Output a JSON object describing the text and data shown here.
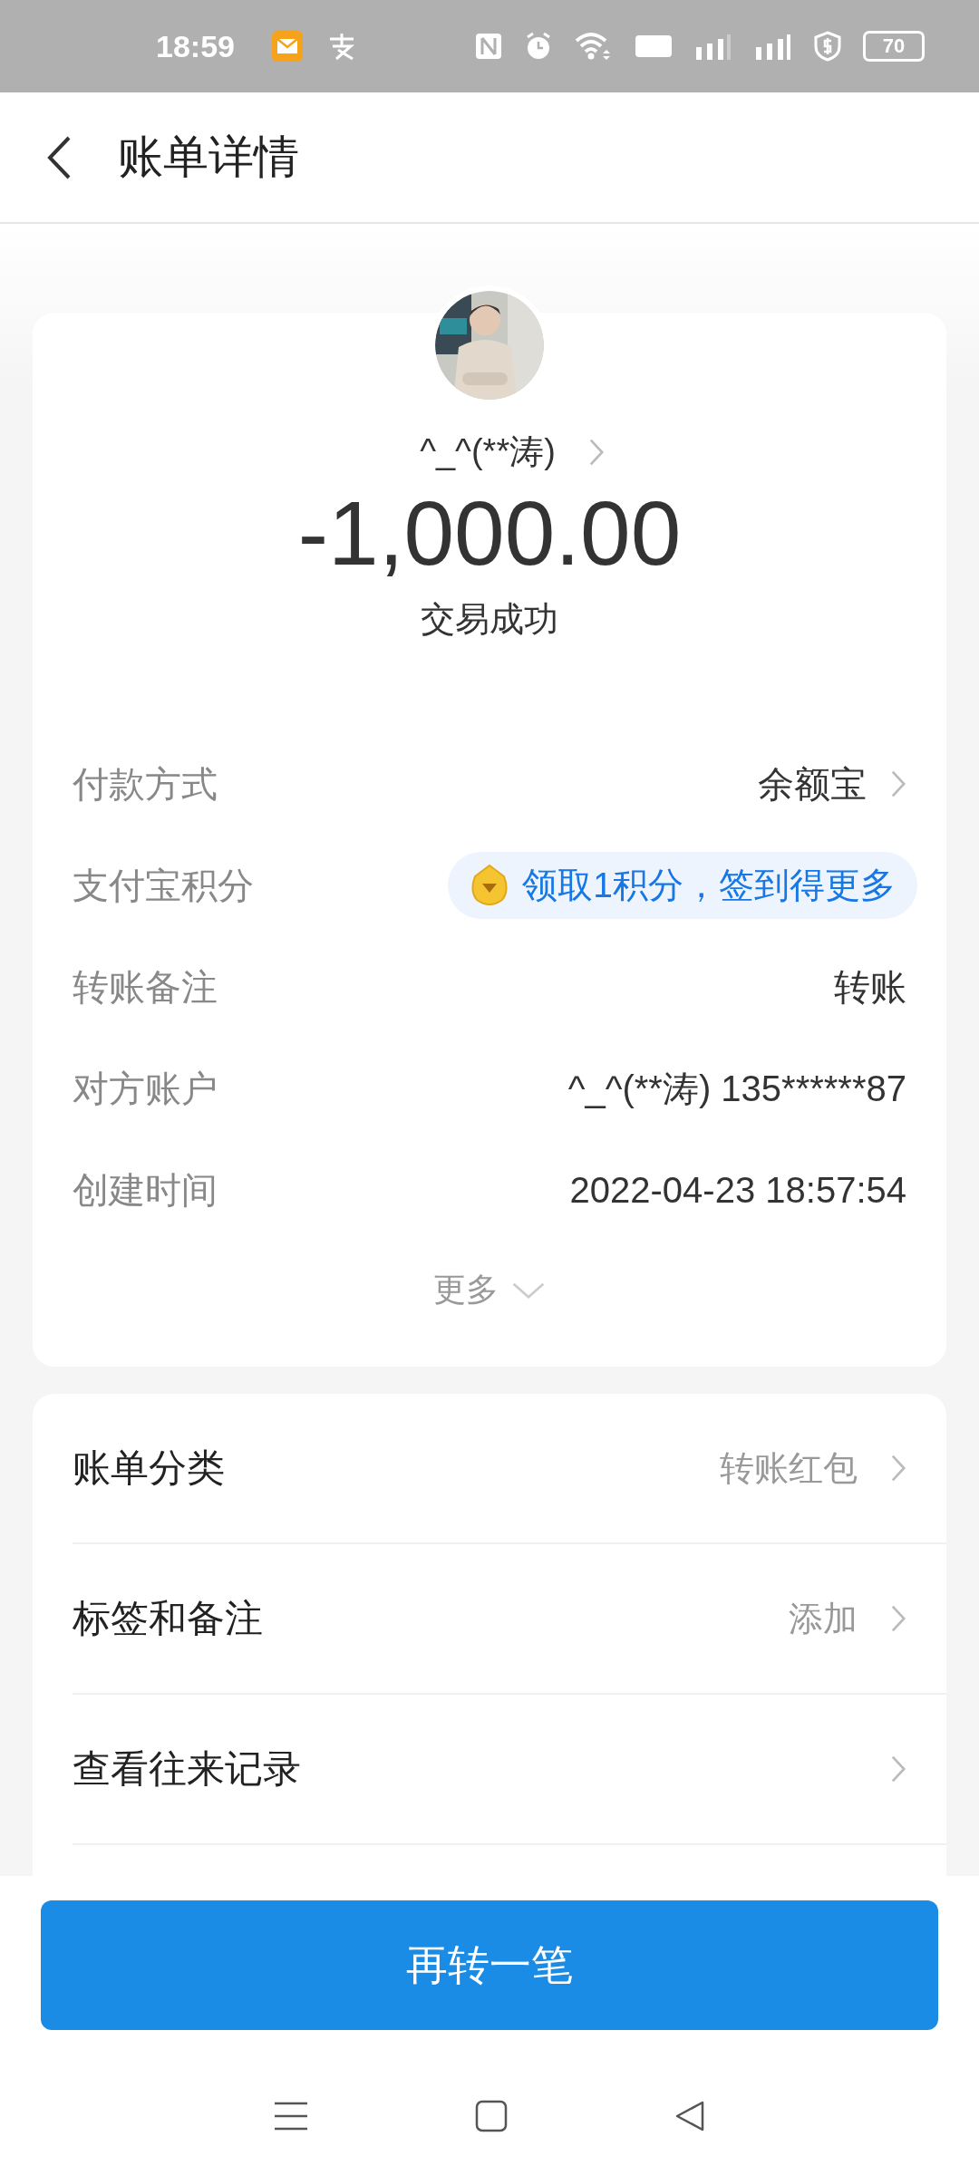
{
  "status_bar": {
    "time": "18:59",
    "battery": "70"
  },
  "header": {
    "title": "账单详情"
  },
  "summary": {
    "name": "^_^(**涛)",
    "amount": "-1,000.00",
    "status": "交易成功"
  },
  "details": [
    {
      "kind": "link",
      "label": "付款方式",
      "value": "余额宝"
    },
    {
      "kind": "points",
      "label": "支付宝积分",
      "value": "领取1积分，签到得更多"
    },
    {
      "kind": "text",
      "label": "转账备注",
      "value": "转账"
    },
    {
      "kind": "text",
      "label": "对方账户",
      "value": "^_^(**涛) 135******87"
    },
    {
      "kind": "text",
      "label": "创建时间",
      "value": "2022-04-23 18:57:54"
    }
  ],
  "more": "更多",
  "actions": [
    {
      "label": "账单分类",
      "value": "转账红包"
    },
    {
      "label": "标签和备注",
      "value": "添加"
    },
    {
      "label": "查看往来记录"
    }
  ],
  "button": "再转一笔"
}
